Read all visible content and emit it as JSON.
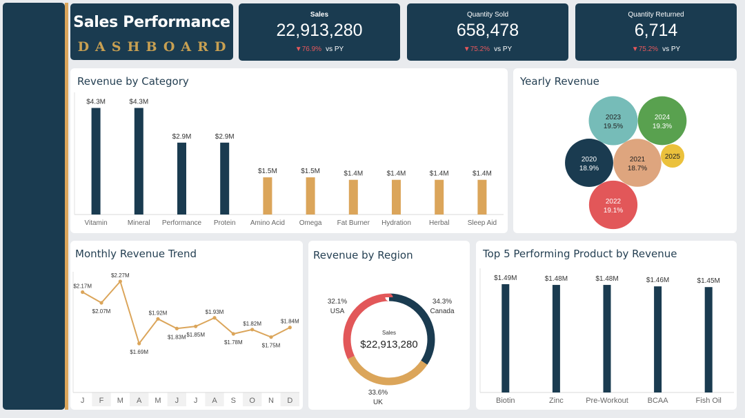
{
  "header": {
    "title": "Sales Performance",
    "subtitle": "DASHBOARD"
  },
  "kpis": [
    {
      "label": "Sales",
      "value": "22,913,280",
      "delta": "76.9%",
      "vs": "vs PY",
      "arrow": "▼"
    },
    {
      "label": "Quantity Sold",
      "value": "658,478",
      "delta": "75.2%",
      "vs": "vs PY",
      "arrow": "▼"
    },
    {
      "label": "Quantity Returned",
      "value": "6,714",
      "delta": "75.2%",
      "vs": "vs PY",
      "arrow": "▼"
    }
  ],
  "colors": {
    "navy": "#1a3b50",
    "gold": "#dba55a",
    "red": "#e25759",
    "teal": "#76bcb8",
    "green": "#59a14f",
    "peach": "#dea57e",
    "yellow": "#ebc13c"
  },
  "titles": {
    "category": "Revenue by Category",
    "yearly": "Yearly Revenue",
    "monthly": "Monthly Revenue Trend",
    "region": "Revenue by Region",
    "top5": "Top 5 Performing Product by Revenue"
  },
  "chart_data": [
    {
      "id": "category",
      "type": "bar",
      "title": "Revenue by Category",
      "categories": [
        "Vitamin",
        "Mineral",
        "Performance",
        "Protein",
        "Amino Acid",
        "Omega",
        "Fat Burner",
        "Hydration",
        "Herbal",
        "Sleep Aid"
      ],
      "values": [
        4.3,
        4.3,
        2.9,
        2.9,
        1.5,
        1.5,
        1.4,
        1.4,
        1.4,
        1.4
      ],
      "labels": [
        "$4.3M",
        "$4.3M",
        "$2.9M",
        "$2.9M",
        "$1.5M",
        "$1.5M",
        "$1.4M",
        "$1.4M",
        "$1.4M",
        "$1.4M"
      ],
      "bar_colors": [
        "#1a3b50",
        "#1a3b50",
        "#1a3b50",
        "#1a3b50",
        "#dba55a",
        "#dba55a",
        "#dba55a",
        "#dba55a",
        "#dba55a",
        "#dba55a"
      ],
      "ylim": [
        0,
        4.5
      ]
    },
    {
      "id": "yearly",
      "type": "bubble",
      "title": "Yearly Revenue",
      "items": [
        {
          "year": "2023",
          "pct": "19.5%",
          "value": 19.5,
          "color": "#76bcb8"
        },
        {
          "year": "2024",
          "pct": "19.3%",
          "value": 19.3,
          "color": "#59a14f"
        },
        {
          "year": "2020",
          "pct": "18.9%",
          "value": 18.9,
          "color": "#1a3b50"
        },
        {
          "year": "2021",
          "pct": "18.7%",
          "value": 18.7,
          "color": "#dea57e"
        },
        {
          "year": "2025",
          "pct": "",
          "value": 4.5,
          "color": "#ebc13c"
        },
        {
          "year": "2022",
          "pct": "19.1%",
          "value": 19.1,
          "color": "#e25759"
        }
      ]
    },
    {
      "id": "monthly",
      "type": "line",
      "title": "Monthly Revenue Trend",
      "categories": [
        "J",
        "F",
        "M",
        "A",
        "M",
        "J",
        "J",
        "A",
        "S",
        "O",
        "N",
        "D"
      ],
      "values": [
        2.17,
        2.07,
        2.27,
        1.69,
        1.92,
        1.83,
        1.85,
        1.93,
        1.78,
        1.82,
        1.75,
        1.84
      ],
      "labels": [
        "$2.17M",
        "$2.07M",
        "$2.27M",
        "$1.69M",
        "$1.92M",
        "$1.83M",
        "$1.85M",
        "$1.93M",
        "$1.78M",
        "$1.82M",
        "$1.75M",
        "$1.84M"
      ],
      "color": "#dba55a"
    },
    {
      "id": "region",
      "type": "pie",
      "title": "Revenue by Region",
      "center_label": "Sales",
      "center_value": "$22,913,280",
      "slices": [
        {
          "name": "Canada",
          "pct": "34.3%",
          "value": 34.3,
          "color": "#1a3b50"
        },
        {
          "name": "UK",
          "pct": "33.6%",
          "value": 33.6,
          "color": "#dba55a"
        },
        {
          "name": "USA",
          "pct": "32.1%",
          "value": 32.1,
          "color": "#e25759"
        }
      ]
    },
    {
      "id": "top5",
      "type": "bar",
      "title": "Top 5 Performing Product by Revenue",
      "categories": [
        "Biotin",
        "Zinc",
        "Pre-Workout",
        "BCAA",
        "Fish Oil"
      ],
      "values": [
        1.49,
        1.48,
        1.48,
        1.46,
        1.45
      ],
      "labels": [
        "$1.49M",
        "$1.48M",
        "$1.48M",
        "$1.46M",
        "$1.45M"
      ],
      "color": "#1a3b50",
      "ylim": [
        0,
        1.6
      ]
    }
  ]
}
